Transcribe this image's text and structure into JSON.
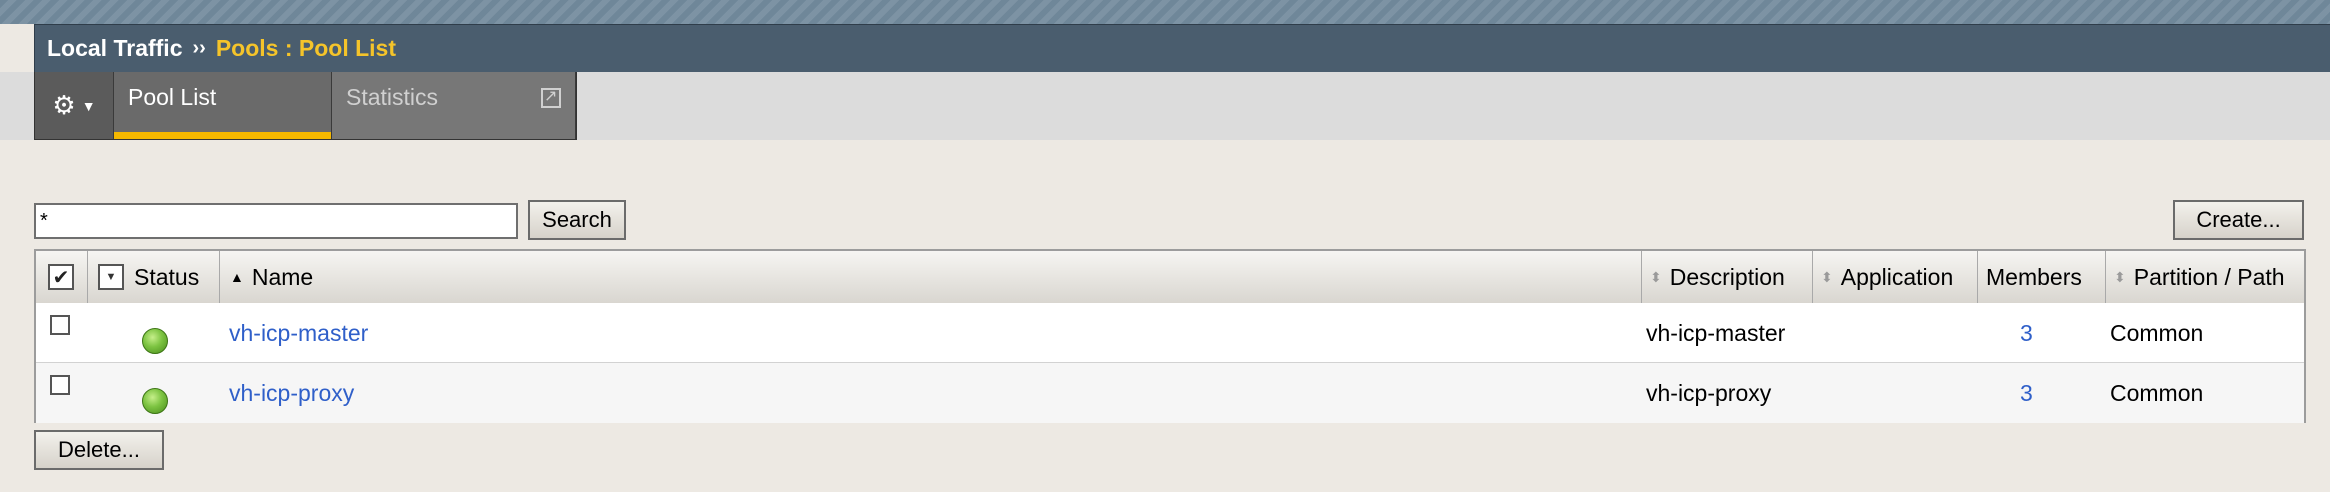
{
  "breadcrumb": {
    "section": "Local Traffic",
    "separator": "››",
    "current": "Pools : Pool List"
  },
  "tabs": {
    "gear_icon": "gear-icon",
    "active_label": "Pool List",
    "inactive_label": "Statistics"
  },
  "search": {
    "value": "*",
    "button_label": "Search"
  },
  "create_label": "Create...",
  "delete_label": "Delete...",
  "table": {
    "columns": [
      "Status",
      "Name",
      "Description",
      "Application",
      "Members",
      "Partition / Path"
    ],
    "rows": [
      {
        "status": "available",
        "name": "vh-icp-master",
        "description": "vh-icp-master",
        "application": "",
        "members": "3",
        "partition": "Common"
      },
      {
        "status": "available",
        "name": "vh-icp-proxy",
        "description": "vh-icp-proxy",
        "application": "",
        "members": "3",
        "partition": "Common"
      }
    ]
  },
  "colors": {
    "titlebar": "#4a5d6e",
    "breadcrumb_current": "#f5c42a",
    "tab_active_underline": "#f5b800",
    "link": "#2f5fc9",
    "status_green": "#7cc341"
  }
}
